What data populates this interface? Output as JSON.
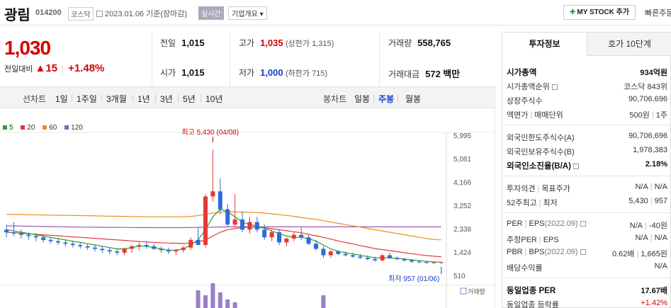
{
  "header": {
    "name": "광림",
    "code": "014200",
    "market": "코스닥",
    "date": "2023.01.06",
    "basis": "기준(장마감)",
    "realtime": "실시간",
    "company_info": "기업개요",
    "mystock": "MY STOCK 추가",
    "quick_order": "빠른주문"
  },
  "price": {
    "current": "1,030",
    "change_label": "전일대비",
    "change_arrow": "▲",
    "change_value": "15",
    "change_pct": "+1.48%"
  },
  "quote": {
    "prev_close": {
      "label": "전일",
      "value": "1,015"
    },
    "open": {
      "label": "시가",
      "value": "1,015"
    },
    "high": {
      "label": "고가",
      "value": "1,035",
      "sub": "(상한가 1,315)"
    },
    "low": {
      "label": "저가",
      "value": "1,000",
      "sub": "(하한가 715)"
    },
    "volume": {
      "label": "거래량",
      "value": "558,765"
    },
    "amount": {
      "label": "거래대금",
      "value": "572",
      "unit": "백만"
    }
  },
  "period_bar": {
    "line_label": "선차트",
    "line_periods": [
      "1일",
      "1주일",
      "3개월",
      "1년",
      "3년",
      "5년",
      "10년"
    ],
    "candle_label": "봉차트",
    "candle_periods": [
      "일봉",
      "주봉",
      "월봉"
    ],
    "active_candle": "주봉"
  },
  "chart_data": {
    "type": "candlestick",
    "legend": [
      {
        "name": "5",
        "color": "#2ca02c"
      },
      {
        "name": "20",
        "color": "#e53935"
      },
      {
        "name": "60",
        "color": "#f08c1a"
      },
      {
        "name": "120",
        "color": "#9b59b6"
      }
    ],
    "y_ticks": [
      5995,
      5081,
      4166,
      3252,
      2338,
      1424,
      510
    ],
    "ylim": [
      510,
      5995
    ],
    "high_label": "최고 5,430 (04/08)",
    "low_label": "최저 957 (01/06)",
    "volume_label": "거래량",
    "candles": [
      [
        2300,
        2500,
        2000,
        2200
      ],
      [
        2200,
        2600,
        2050,
        2150
      ],
      [
        2150,
        2300,
        1950,
        2100
      ],
      [
        2100,
        2200,
        1900,
        2050
      ],
      [
        2050,
        2150,
        1850,
        2000
      ],
      [
        2000,
        2100,
        1800,
        1900
      ],
      [
        1900,
        2000,
        1750,
        1850
      ],
      [
        1850,
        1950,
        1700,
        1800
      ],
      [
        1800,
        1900,
        1650,
        1750
      ],
      [
        1750,
        1850,
        1600,
        1700
      ],
      [
        1700,
        1800,
        1550,
        1650
      ],
      [
        1650,
        1750,
        1500,
        1600
      ],
      [
        1600,
        1700,
        1450,
        1550
      ],
      [
        1550,
        1650,
        1400,
        1500
      ],
      [
        1500,
        1600,
        1350,
        1450
      ],
      [
        1450,
        1550,
        1300,
        1400
      ],
      [
        1400,
        1600,
        1300,
        1550
      ],
      [
        1550,
        1700,
        1400,
        1650
      ],
      [
        1650,
        1800,
        1500,
        1700
      ],
      [
        1700,
        1850,
        1550,
        1650
      ],
      [
        1650,
        1750,
        1500,
        1550
      ],
      [
        1550,
        1650,
        1400,
        1500
      ],
      [
        1500,
        1600,
        1350,
        1450
      ],
      [
        1450,
        1550,
        1300,
        1500
      ],
      [
        1500,
        1650,
        1400,
        1600
      ],
      [
        1600,
        2000,
        1500,
        1900
      ],
      [
        1900,
        2400,
        1800,
        1700
      ],
      [
        1700,
        3700,
        1600,
        3600
      ],
      [
        3600,
        5430,
        3400,
        3800
      ],
      [
        3800,
        4300,
        2900,
        3100
      ],
      [
        3100,
        3300,
        2400,
        2500
      ],
      [
        2500,
        3700,
        2400,
        2700
      ],
      [
        2700,
        3000,
        2200,
        2300
      ],
      [
        2300,
        2800,
        2150,
        2600
      ],
      [
        2600,
        2800,
        2200,
        2300
      ],
      [
        2300,
        2500,
        1900,
        2000
      ],
      [
        2000,
        2300,
        1850,
        2200
      ],
      [
        2200,
        2300,
        1700,
        1800
      ],
      [
        1800,
        2000,
        1650,
        1950
      ],
      [
        1950,
        2200,
        1850,
        2100
      ],
      [
        2100,
        2400,
        1900,
        2000
      ],
      [
        2000,
        2100,
        1700,
        1750
      ],
      [
        1750,
        1900,
        1500,
        1550
      ],
      [
        1550,
        1650,
        1200,
        1300
      ],
      [
        1300,
        1500,
        1200,
        1450
      ],
      [
        1450,
        1500,
        1300,
        1350
      ],
      [
        1350,
        1450,
        1250,
        1300
      ],
      [
        1300,
        1400,
        1200,
        1250
      ],
      [
        1250,
        1350,
        1150,
        1200
      ],
      [
        1200,
        1300,
        1100,
        1150
      ],
      [
        1150,
        1250,
        1050,
        1100
      ],
      [
        1100,
        1350,
        1050,
        1300
      ],
      [
        1300,
        1400,
        1150,
        1200
      ],
      [
        1200,
        1250,
        1100,
        1150
      ],
      [
        1150,
        1200,
        1050,
        1100
      ],
      [
        1100,
        1150,
        1000,
        1050
      ],
      [
        1050,
        1100,
        980,
        1030
      ],
      [
        1030,
        1080,
        970,
        1000
      ],
      [
        1000,
        1050,
        960,
        1020
      ],
      [
        1020,
        1040,
        957,
        1030
      ]
    ],
    "ma5": [
      2300,
      2250,
      2200,
      2150,
      2100,
      2050,
      2000,
      1950,
      1900,
      1850,
      1800,
      1750,
      1700,
      1650,
      1600,
      1550,
      1550,
      1600,
      1650,
      1650,
      1600,
      1550,
      1500,
      1500,
      1550,
      1700,
      1900,
      2300,
      2800,
      3100,
      3000,
      2800,
      2600,
      2500,
      2450,
      2350,
      2250,
      2150,
      2050,
      2000,
      2000,
      1950,
      1850,
      1700,
      1550,
      1450,
      1400,
      1350,
      1300,
      1250,
      1200,
      1200,
      1200,
      1180,
      1150,
      1120,
      1090,
      1060,
      1040,
      1030
    ],
    "ma20": [
      2200,
      2180,
      2160,
      2140,
      2120,
      2100,
      2080,
      2060,
      2040,
      2020,
      2000,
      1980,
      1960,
      1940,
      1920,
      1900,
      1880,
      1860,
      1840,
      1820,
      1800,
      1790,
      1780,
      1770,
      1760,
      1780,
      1820,
      1900,
      2050,
      2200,
      2300,
      2350,
      2380,
      2400,
      2390,
      2370,
      2340,
      2300,
      2260,
      2220,
      2180,
      2120,
      2060,
      2000,
      1930,
      1860,
      1800,
      1740,
      1680,
      1620,
      1560,
      1520,
      1480,
      1440,
      1400,
      1360,
      1320,
      1290,
      1260,
      1240
    ],
    "ma60": [
      2900,
      2895,
      2890,
      2885,
      2880,
      2875,
      2870,
      2865,
      2860,
      2855,
      2850,
      2845,
      2840,
      2835,
      2830,
      2825,
      2820,
      2815,
      2810,
      2805,
      2800,
      2800,
      2800,
      2800,
      2800,
      2820,
      2850,
      2900,
      2950,
      2980,
      3000,
      3000,
      2990,
      2980,
      2970,
      2950,
      2920,
      2890,
      2860,
      2820,
      2780,
      2740,
      2700,
      2650,
      2600,
      2550,
      2500,
      2450,
      2400,
      2350,
      2300,
      2250,
      2200,
      2150,
      2100,
      2050,
      2000,
      1950,
      1920,
      1900
    ],
    "ma120": [
      2450,
      2445,
      2440,
      2435,
      2430,
      2425,
      2420,
      2415,
      2410,
      2405,
      2400,
      2398,
      2396,
      2394,
      2392,
      2390,
      2388,
      2386,
      2384,
      2382,
      2380,
      2380,
      2380,
      2380,
      2380,
      2385,
      2390,
      2395,
      2400,
      2405,
      2410,
      2410,
      2410,
      2410,
      2410,
      2410,
      2410,
      2410,
      2410,
      2410,
      2410,
      2410,
      2410,
      2410,
      2410,
      2410,
      2410,
      2410,
      2410,
      2410,
      2410,
      2410,
      2410,
      2410,
      2410,
      2410,
      2410,
      2410,
      2410,
      2410
    ],
    "volume": [
      0,
      0,
      0,
      0,
      0,
      0,
      0,
      0,
      0,
      0,
      0,
      0,
      0,
      0,
      0,
      0,
      0,
      0,
      0,
      0,
      0,
      0,
      0,
      0,
      0,
      0,
      25,
      18,
      35,
      22,
      12,
      8,
      0,
      0,
      0,
      0,
      0,
      0,
      0,
      0,
      0,
      0,
      0,
      18,
      0,
      0,
      0,
      0,
      0,
      0,
      0,
      0,
      0,
      0,
      0,
      0,
      0,
      0,
      0,
      0
    ]
  },
  "invest_panel": {
    "tab_active": "투자정보",
    "tab_other": "호가 10단계",
    "rows1": [
      {
        "label": "시가총액",
        "value": "934억원",
        "bold": true
      },
      {
        "label": "시가총액순위",
        "value": "코스닥 843위",
        "q": true
      },
      {
        "label": "상장주식수",
        "value": "90,706,696"
      },
      {
        "label": "액면가",
        "label2": "매매단위",
        "value": "500원",
        "value2": "1주"
      }
    ],
    "rows2": [
      {
        "label": "외국인한도주식수(A)",
        "value": "90,706,696"
      },
      {
        "label": "외국인보유주식수(B)",
        "value": "1,978,383"
      },
      {
        "label": "외국인소진율(B/A)",
        "value": "2.18%",
        "bold": true,
        "q": true
      }
    ],
    "rows3": [
      {
        "label": "투자의견",
        "label2": "목표주가",
        "value": "N/A",
        "value2": "N/A"
      },
      {
        "label": "52주최고",
        "label2": "최저",
        "value": "5,430",
        "value2": "957"
      }
    ],
    "rows4": [
      {
        "label": "PER",
        "label2": "EPS",
        "label3": "(2022.09)",
        "value": "N/A",
        "value2": "-40원"
      },
      {
        "label": "추정PER",
        "label2": "EPS",
        "value": "N/A",
        "value2": "N/A"
      },
      {
        "label": "PBR",
        "label2": "BPS",
        "label3": "(2022.09)",
        "value": "0.62배",
        "value2": "1,665원"
      },
      {
        "label": "배당수익률",
        "value": "N/A"
      }
    ],
    "rows5": [
      {
        "label": "동일업종 PER",
        "value": "17.67배",
        "bold": true
      },
      {
        "label": "동일업종 등락률",
        "value": "+1.42%",
        "red": true
      }
    ]
  }
}
